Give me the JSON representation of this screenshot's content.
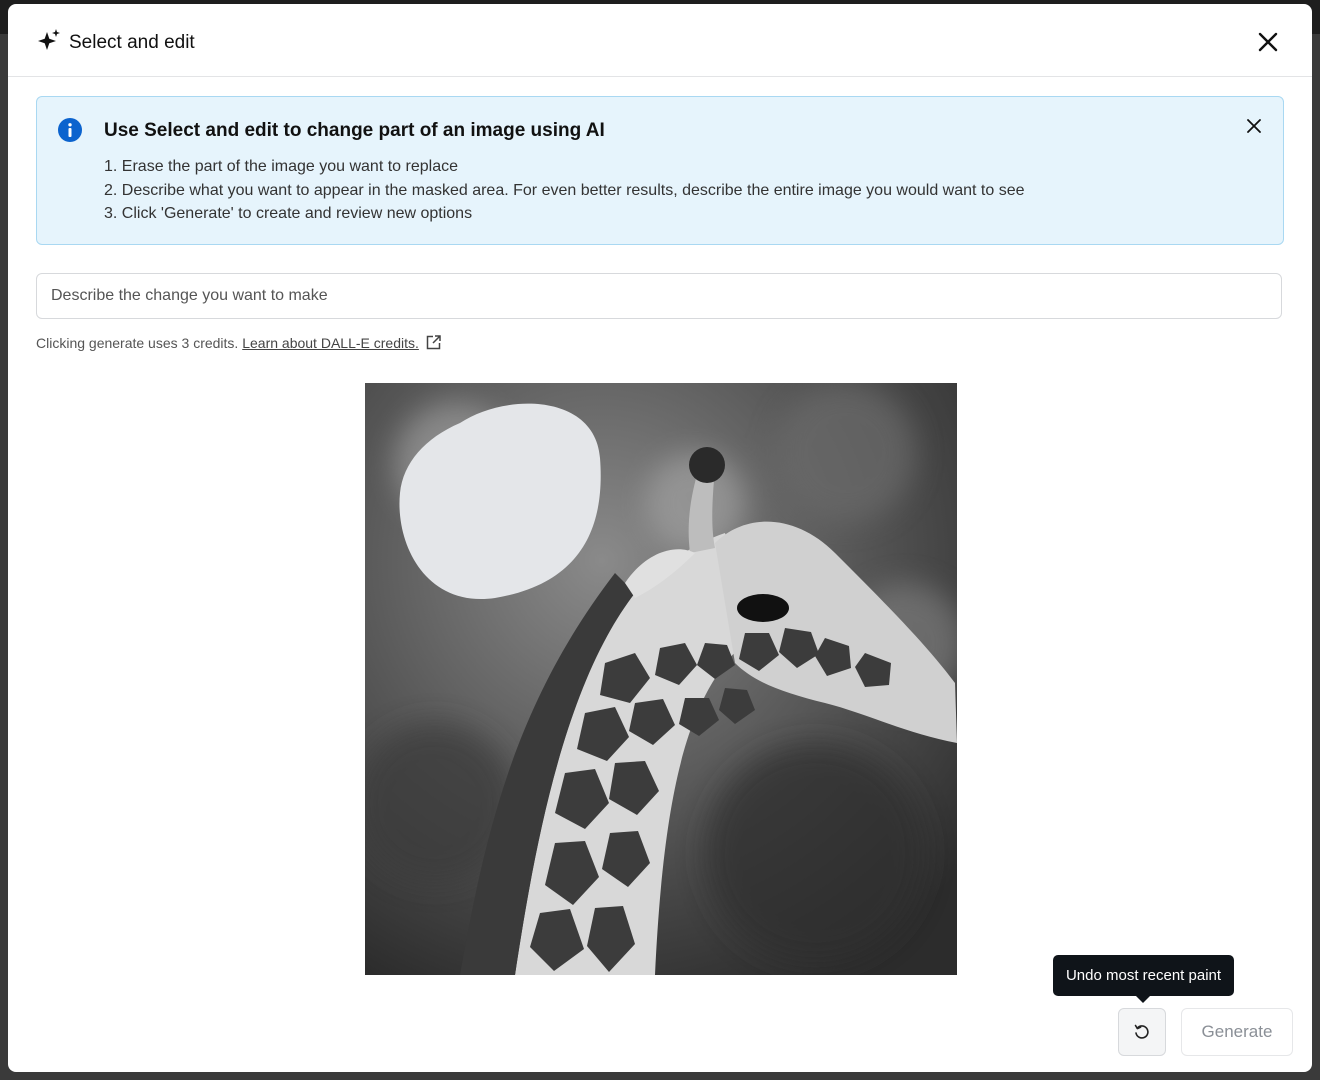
{
  "dialog": {
    "title": "Select and edit",
    "title_icon": "sparkle-icon",
    "close_icon": "close-icon"
  },
  "banner": {
    "icon": "info-icon",
    "title": "Use Select and edit to change part of an image using AI",
    "steps": [
      "1. Erase the part of the image you want to replace",
      "2. Describe what you want to appear in the masked area. For even better results, describe the entire image you would want to see",
      "3. Click 'Generate' to create and review new options"
    ],
    "close_icon": "close-icon",
    "colors": {
      "background": "#e6f4fc",
      "border": "#a9d8f2",
      "icon": "#0b63ce"
    }
  },
  "prompt": {
    "value": "",
    "placeholder": "Describe the change you want to make"
  },
  "credits": {
    "text": "Clicking generate uses 3 credits.",
    "link_label": "Learn about DALL-E credits.",
    "link_icon": "external-link-icon"
  },
  "image": {
    "subject": "giraffe",
    "mask_color": "#e4e6e9"
  },
  "tooltip": {
    "text": "Undo most recent paint"
  },
  "actions": {
    "undo_icon": "undo-icon",
    "generate_label": "Generate"
  }
}
